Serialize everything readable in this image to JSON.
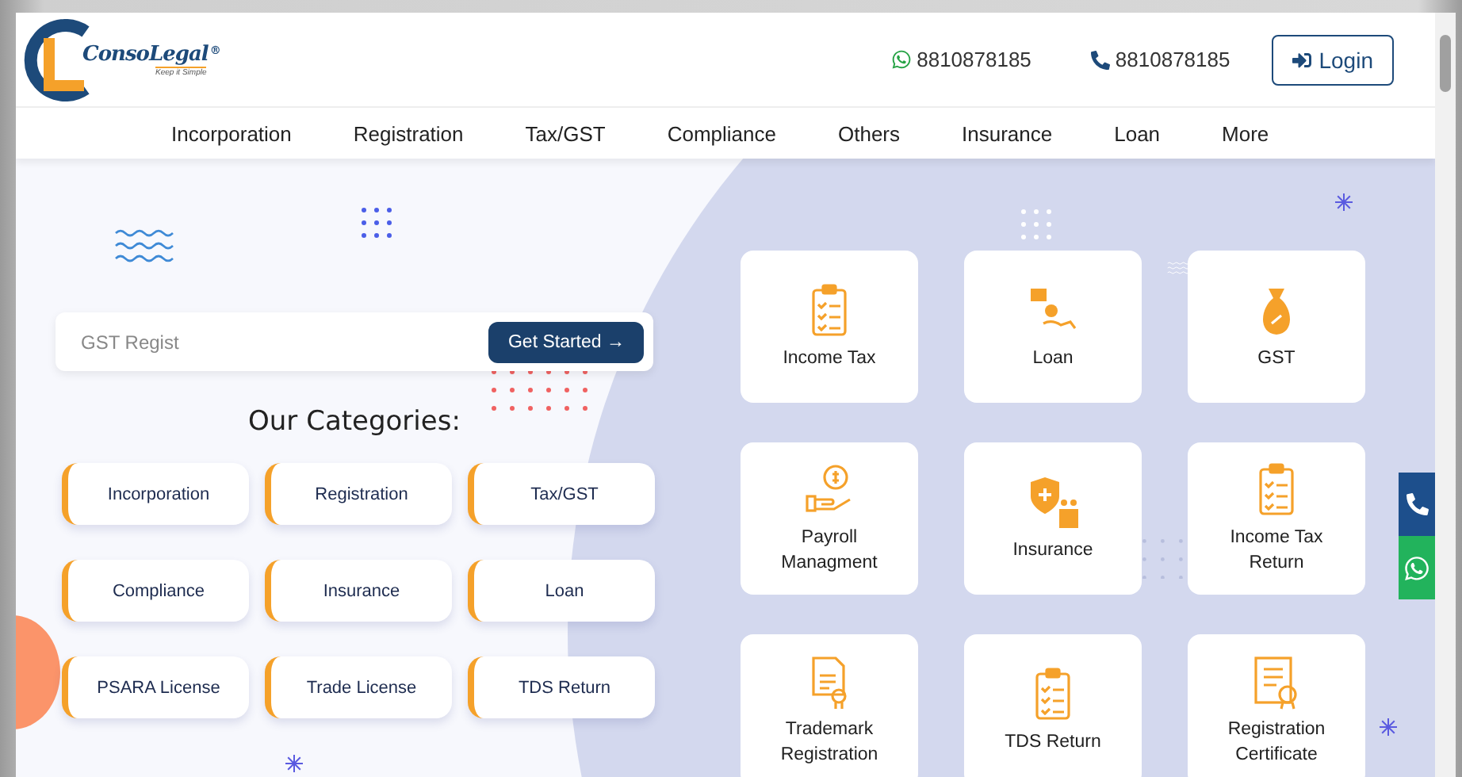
{
  "header": {
    "logo": {
      "name": "ConsoLegal",
      "registered_mark": "®",
      "tagline": "Keep it Simple"
    },
    "contacts": [
      {
        "kind": "whatsapp",
        "number": "8810878185"
      },
      {
        "kind": "phone",
        "number": "8810878185"
      }
    ],
    "login_button": "Login"
  },
  "nav": [
    "Incorporation",
    "Registration",
    "Tax/GST",
    "Compliance",
    "Others",
    "Insurance",
    "Loan",
    "More"
  ],
  "search": {
    "placeholder": "GST Regist",
    "button": "Get Started →"
  },
  "categories_title": "Our Categories:",
  "categories": [
    "Incorporation",
    "Registration",
    "Tax/GST",
    "Compliance",
    "Insurance",
    "Loan",
    "PSARA License",
    "Trade License",
    "TDS Return"
  ],
  "services": [
    {
      "label": "Income Tax",
      "kind": "clipboard"
    },
    {
      "label": "Loan",
      "kind": "loan"
    },
    {
      "label": "GST",
      "kind": "bag"
    },
    {
      "label": "Payroll Managment",
      "kind": "payroll"
    },
    {
      "label": "Insurance",
      "kind": "insurance"
    },
    {
      "label": "Income Tax Return",
      "kind": "clipboard"
    },
    {
      "label": "Trademark Registration",
      "kind": "trademark"
    },
    {
      "label": "TDS Return",
      "kind": "clipboard"
    },
    {
      "label": "Registration Certificate",
      "kind": "certificate"
    }
  ]
}
